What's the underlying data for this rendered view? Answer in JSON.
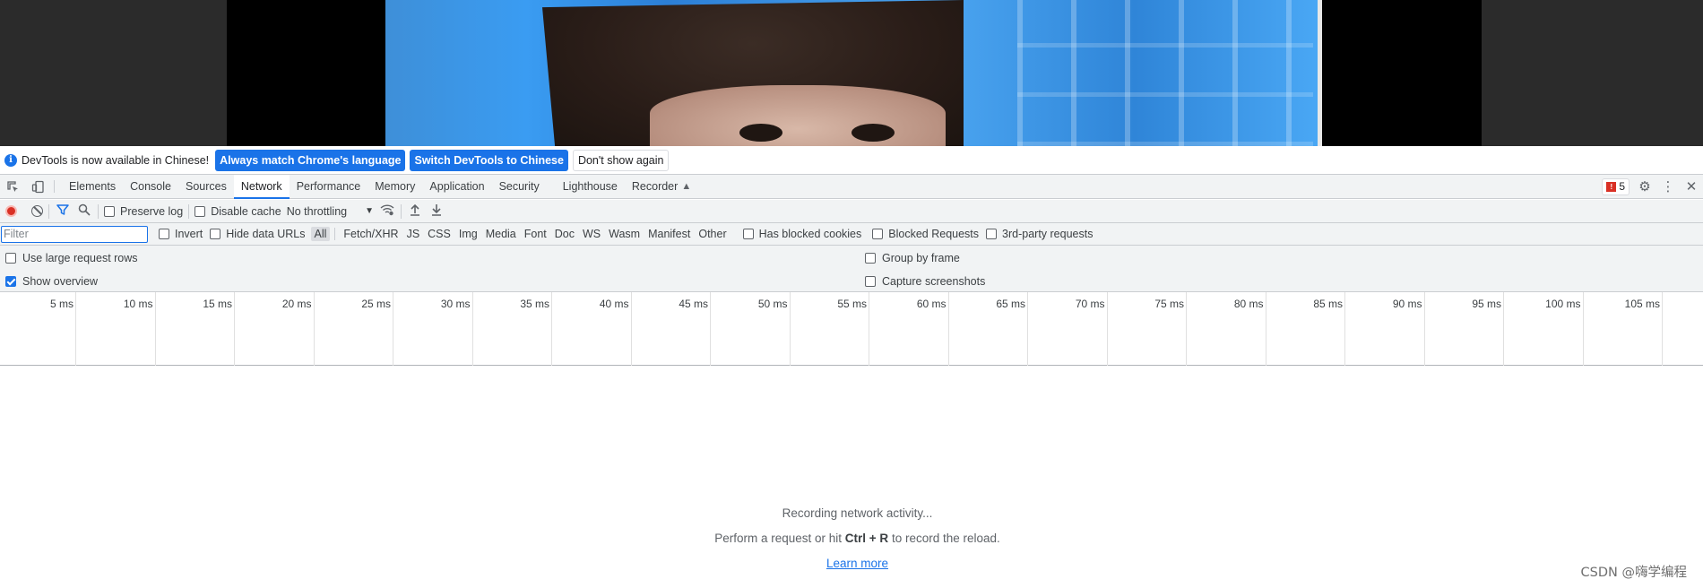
{
  "infobar": {
    "message": "DevTools is now available in Chinese!",
    "match_language_label": "Always match Chrome's language",
    "switch_label": "Switch DevTools to Chinese",
    "dismiss_label": "Don't show again"
  },
  "tabs": [
    {
      "label": "Elements"
    },
    {
      "label": "Console"
    },
    {
      "label": "Sources"
    },
    {
      "label": "Network",
      "selected": true
    },
    {
      "label": "Performance"
    },
    {
      "label": "Memory"
    },
    {
      "label": "Application"
    },
    {
      "label": "Security"
    },
    {
      "label": "Lighthouse"
    },
    {
      "label": "Recorder"
    }
  ],
  "issues_count": "5",
  "network_toolbar": {
    "preserve_log": "Preserve log",
    "disable_cache": "Disable cache",
    "throttling": "No throttling"
  },
  "filter": {
    "placeholder": "Filter",
    "invert": "Invert",
    "hide_data_urls": "Hide data URLs",
    "types": [
      "All",
      "Fetch/XHR",
      "JS",
      "CSS",
      "Img",
      "Media",
      "Font",
      "Doc",
      "WS",
      "Wasm",
      "Manifest",
      "Other"
    ],
    "has_blocked_cookies": "Has blocked cookies",
    "blocked_requests": "Blocked Requests",
    "third_party": "3rd-party requests"
  },
  "settings": {
    "large_rows": "Use large request rows",
    "group_by_frame": "Group by frame",
    "show_overview": "Show overview",
    "show_overview_checked": true,
    "capture_screenshots": "Capture screenshots"
  },
  "timeline_ticks": [
    "5 ms",
    "10 ms",
    "15 ms",
    "20 ms",
    "25 ms",
    "30 ms",
    "35 ms",
    "40 ms",
    "45 ms",
    "50 ms",
    "55 ms",
    "60 ms",
    "65 ms",
    "70 ms",
    "75 ms",
    "80 ms",
    "85 ms",
    "90 ms",
    "95 ms",
    "100 ms",
    "105 ms"
  ],
  "empty_state": {
    "recording": "Recording network activity...",
    "instruction_prefix": "Perform a request or hit",
    "shortcut": "Ctrl + R",
    "instruction_suffix": "to record the reload.",
    "learn_more": "Learn more"
  },
  "watermark": "CSDN @嗨学编程",
  "colors": {
    "accent": "#1a73e8",
    "record_red": "#d93025",
    "toolbar_bg": "#f1f3f4"
  }
}
